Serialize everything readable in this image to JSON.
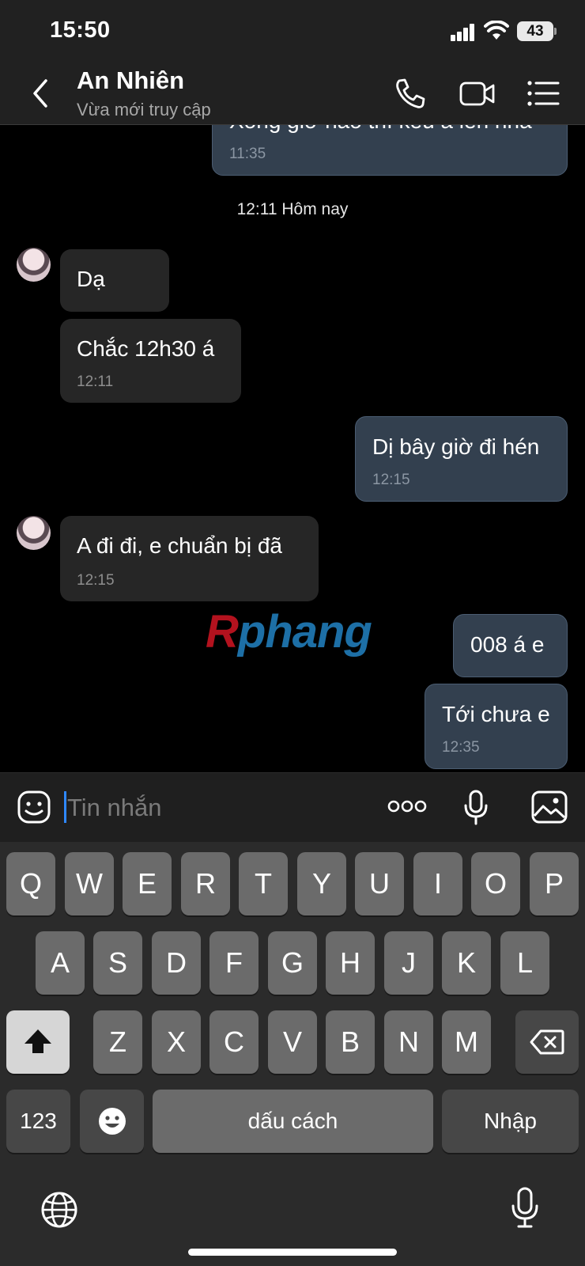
{
  "status_bar": {
    "time": "15:50",
    "battery": "43"
  },
  "header": {
    "contact_name": "An Nhiên",
    "contact_status": "Vừa mới truy cập"
  },
  "messages": [
    {
      "direction": "out",
      "text": "Xong giờ nào thì kêu a lên nha",
      "time": "11:35"
    },
    {
      "direction": "in",
      "text": "Dạ"
    },
    {
      "direction": "in",
      "text": "Chắc 12h30 á",
      "time": "12:11"
    },
    {
      "direction": "out",
      "text": "Dị bây giờ đi hén",
      "time": "12:15"
    },
    {
      "direction": "in",
      "text": "A đi đi, e chuẩn bị đã",
      "time": "12:15"
    },
    {
      "direction": "out",
      "text": "008 á e"
    },
    {
      "direction": "out",
      "text": "Tới chưa e",
      "time": "12:35"
    }
  ],
  "date_separator": "12:11 Hôm nay",
  "watermark": {
    "first": "R",
    "rest": "phang"
  },
  "input": {
    "placeholder": "Tin nhắn"
  },
  "keyboard": {
    "row1": [
      "Q",
      "W",
      "E",
      "R",
      "T",
      "Y",
      "U",
      "I",
      "O",
      "P"
    ],
    "row2": [
      "A",
      "S",
      "D",
      "F",
      "G",
      "H",
      "J",
      "K",
      "L"
    ],
    "row3": [
      "Z",
      "X",
      "C",
      "V",
      "B",
      "N",
      "M"
    ],
    "numbers_key": "123",
    "space_key": "dấu cách",
    "enter_key": "Nhập"
  }
}
